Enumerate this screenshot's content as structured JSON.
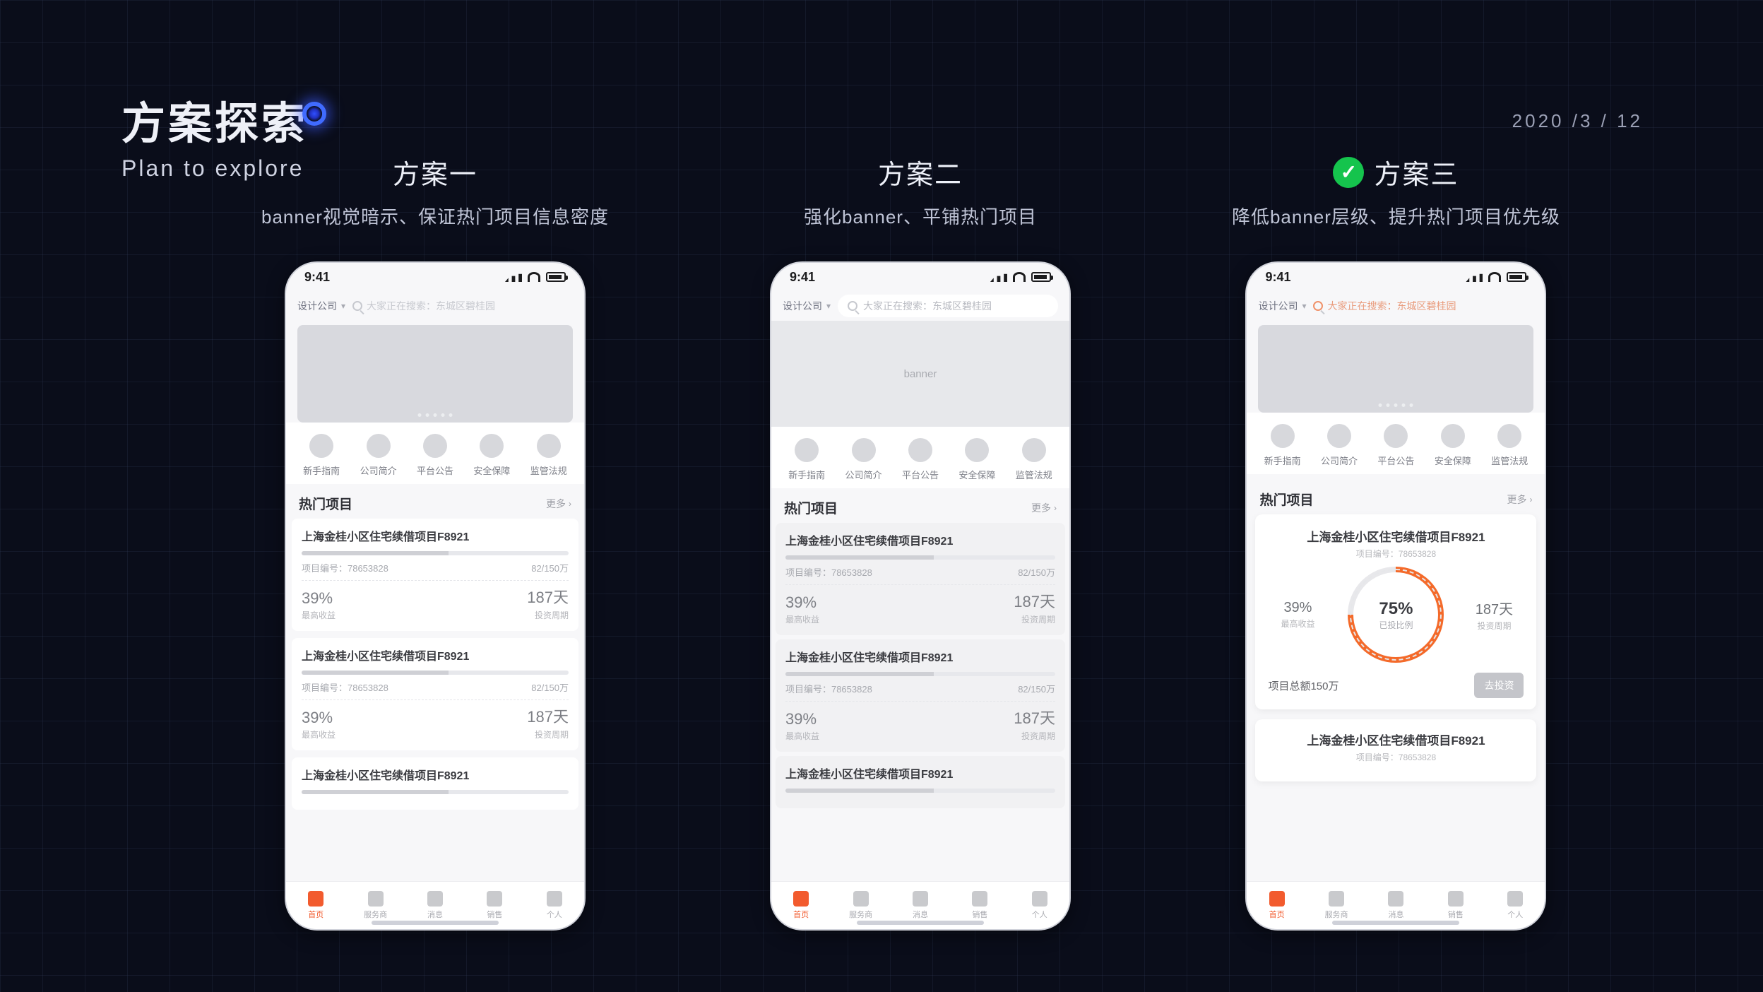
{
  "page": {
    "date": "2020 /3 / 12",
    "title_cn": "方案探索",
    "title_en": "Plan to explore"
  },
  "plans": [
    {
      "title": "方案一",
      "sub": "banner视觉暗示、保证热门项目信息密度",
      "selected": false
    },
    {
      "title": "方案二",
      "sub": "强化banner、平铺热门项目",
      "selected": false
    },
    {
      "title": "方案三",
      "sub": "降低banner层级、提升热门项目优先级",
      "selected": true
    }
  ],
  "phone": {
    "time": "9:41",
    "company": "设计公司",
    "search_hint": "大家正在搜索：东城区碧桂园",
    "banner_text": "banner",
    "nav": [
      "新手指南",
      "公司简介",
      "平台公告",
      "安全保障",
      "监管法规"
    ],
    "section_title": "热门项目",
    "more": "更多",
    "card": {
      "title": "上海金桂小区住宅续借项目F8921",
      "meta_l": "项目编号：78653828",
      "meta_l_label": "项目编号：",
      "meta_l_value": "78653828",
      "meta_r": "82/150万",
      "pct": "39%",
      "pct_label": "最高收益",
      "days": "187天",
      "days_label": "投资周期"
    },
    "card3": {
      "donut_pct": "75%",
      "donut_label": "已投比例",
      "foot": "项目总额150万",
      "btn": "去投资"
    },
    "tabs": [
      "首页",
      "服务商",
      "消息",
      "销售",
      "个人"
    ]
  }
}
